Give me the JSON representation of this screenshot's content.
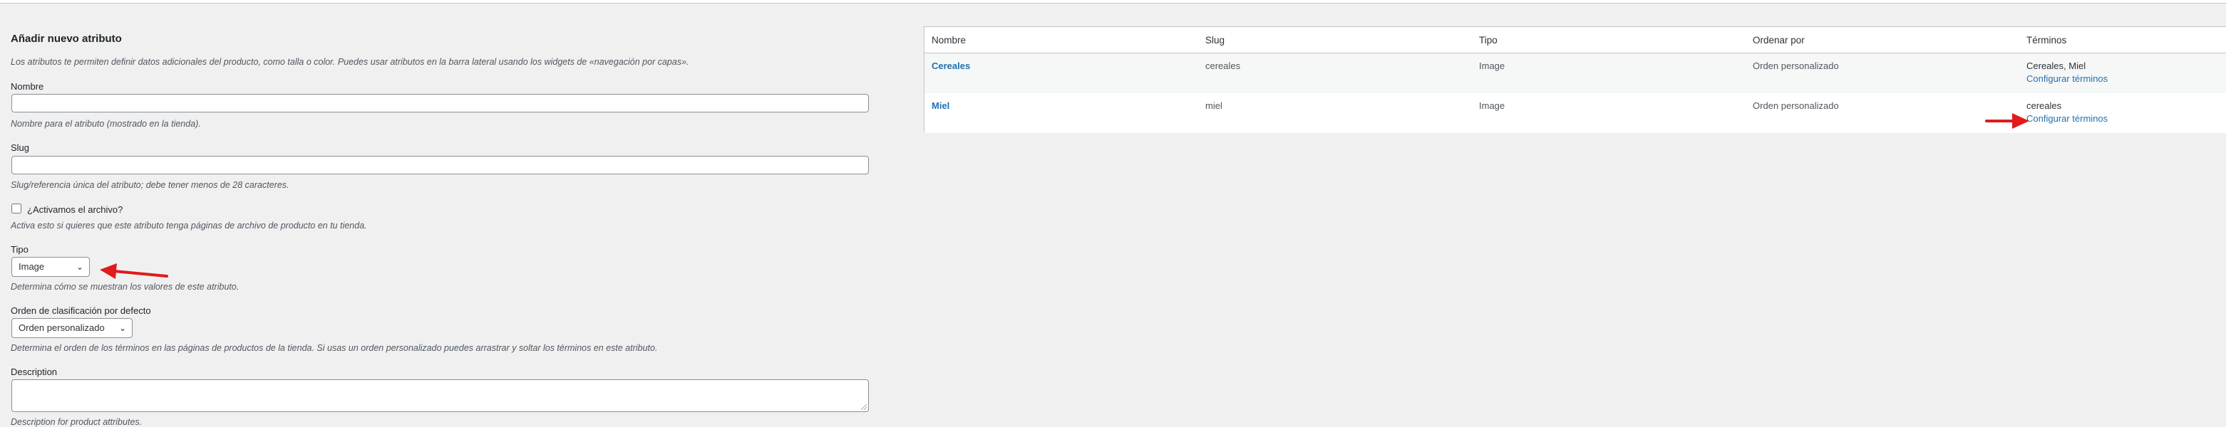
{
  "form": {
    "title": "Añadir nuevo atributo",
    "intro": "Los atributos te permiten definir datos adicionales del producto, como talla o color. Puedes usar atributos en la barra lateral usando los widgets de «navegación por capas».",
    "name_label": "Nombre",
    "name_value": "",
    "name_help": "Nombre para el atributo (mostrado en la tienda).",
    "slug_label": "Slug",
    "slug_value": "",
    "slug_help": "Slug/referencia única del atributo; debe tener menos de 28 caracteres.",
    "archive_label": "¿Activamos el archivo?",
    "archive_checked": false,
    "archive_help": "Activa esto si quieres que este atributo tenga páginas de archivo de producto en tu tienda.",
    "type_label": "Tipo",
    "type_value": "Image",
    "type_help": "Determina cómo se muestran los valores de este atributo.",
    "order_label": "Orden de clasificación por defecto",
    "order_value": "Orden personalizado",
    "order_help": "Determina el orden de los términos en las páginas de productos de la tienda. Si usas un orden personalizado puedes arrastrar y soltar los términos en este atributo.",
    "description_label": "Description",
    "description_value": "",
    "description_help": "Description for product attributes."
  },
  "table": {
    "headers": [
      "Nombre",
      "Slug",
      "Tipo",
      "Ordenar por",
      "Términos"
    ],
    "rows": [
      {
        "name": "Cereales",
        "slug": "cereales",
        "type": "Image",
        "order": "Orden personalizado",
        "terms": "Cereales, Miel",
        "link": "Configurar términos"
      },
      {
        "name": "Miel",
        "slug": "miel",
        "type": "Image",
        "order": "Orden personalizado",
        "terms": "cereales",
        "link": "Configurar términos"
      }
    ]
  },
  "colors": {
    "link": "#2271b1",
    "annotation_arrow": "#e01b1b",
    "background": "#f0f0f1"
  },
  "icons": {
    "select_caret": "chevron-down-icon",
    "annotation": "red-arrow-icon"
  }
}
